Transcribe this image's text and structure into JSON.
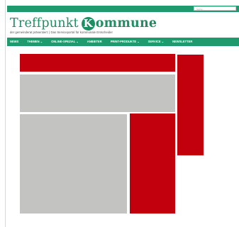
{
  "header": {
    "search": {
      "placeholder": "Suche ..."
    },
    "logo": {
      "word1": "Treffpunkt",
      "k_letter": "K",
      "word2": "ommune"
    },
    "tagline": "der gemeinderat präsentiert: | Das Serviceportal für kommunale Entscheider"
  },
  "nav": {
    "items": [
      {
        "label": "NEWS"
      },
      {
        "label": "THEMEN ⌄"
      },
      {
        "label": "ONLINE-SPEZIAL ⌄"
      },
      {
        "label": "ANBIETER"
      },
      {
        "label": "PRINT-PRODUKTE ⌄"
      },
      {
        "label": "SERVICE ⌄"
      },
      {
        "label": "NEWSLETTER"
      }
    ]
  },
  "colors": {
    "brand_green": "#1e9a6e",
    "ad_red": "#c2000d",
    "placeholder_gray": "#c3c3c1"
  }
}
